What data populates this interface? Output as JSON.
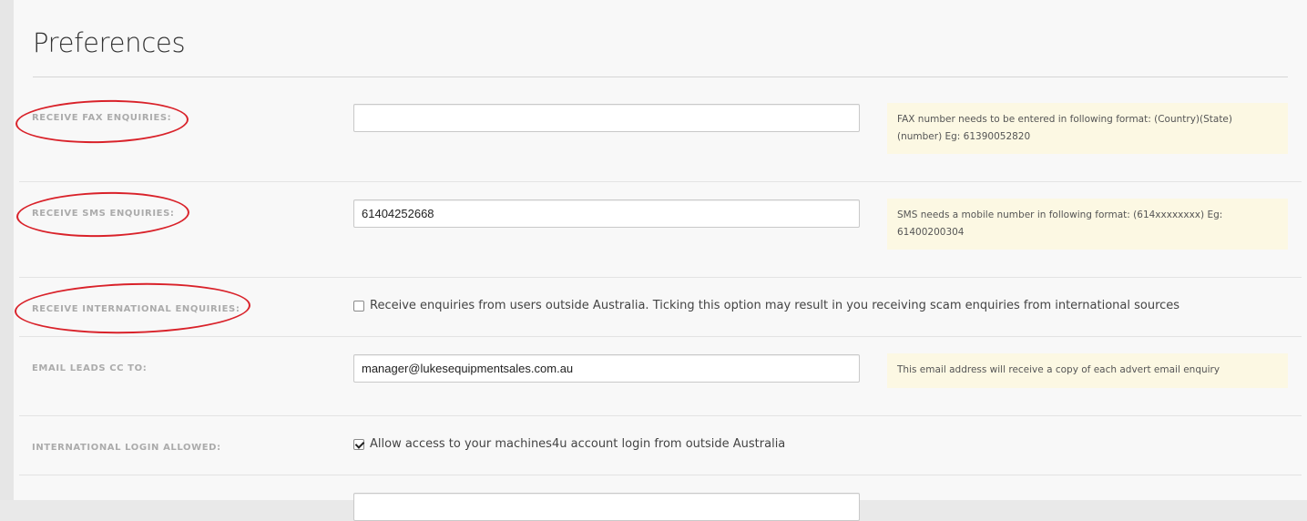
{
  "page": {
    "title": "Preferences"
  },
  "fields": {
    "fax": {
      "label": "RECEIVE FAX ENQUIRIES:",
      "value": "",
      "hint": "FAX number needs to be entered in following format: (Country)(State) (number) Eg: 61390052820"
    },
    "sms": {
      "label": "RECEIVE SMS ENQUIRIES:",
      "value": "61404252668",
      "hint": "SMS needs a mobile number in following format: (614xxxxxxxx) Eg: 61400200304"
    },
    "international": {
      "label": "RECEIVE INTERNATIONAL ENQUIRIES:",
      "checked": false,
      "checkbox_text": "Receive enquiries from users outside Australia. Ticking this option may result in you receiving scam enquiries from international sources"
    },
    "email_cc": {
      "label": "EMAIL LEADS CC TO:",
      "value": "manager@lukesequipmentsales.com.au",
      "hint": "This email address will receive a copy of each advert email enquiry"
    },
    "intl_login": {
      "label": "INTERNATIONAL LOGIN ALLOWED:",
      "checked": true,
      "checkbox_text": "Allow access to your machines4u account login from outside Australia"
    }
  },
  "colors": {
    "annotation": "#d9222a",
    "hint_background": "#fcf8e3",
    "label": "#ababab"
  }
}
